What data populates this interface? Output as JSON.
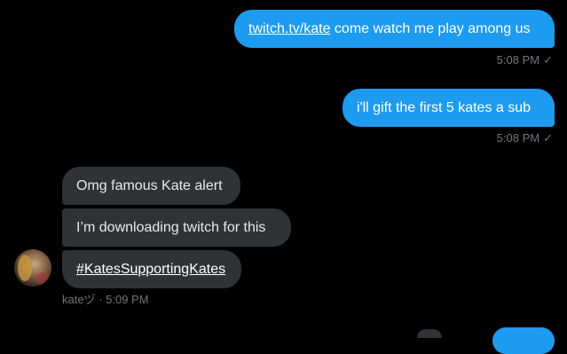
{
  "messages": {
    "sent": [
      {
        "link_text": "twitch.tv/kate",
        "text": " come watch me play among us",
        "time": "5:08 PM",
        "status_icon": "check-icon"
      },
      {
        "text": "i'll gift the first 5 kates a sub",
        "time": "5:08 PM",
        "status_icon": "check-icon"
      }
    ],
    "received": {
      "items": [
        {
          "text": "Omg famous Kate alert"
        },
        {
          "text": "I’m downloading twitch for this"
        },
        {
          "hashtag": "#KatesSupportingKates"
        }
      ],
      "sender": "kateヅ",
      "separator": " · ",
      "time": "5:09 PM",
      "avatar_icon": "user-avatar"
    }
  },
  "glyphs": {
    "check": "✓"
  },
  "colors": {
    "background": "#000000",
    "sent_bubble": "#1d9bf0",
    "received_bubble": "#2f3336",
    "meta_text": "#71767b"
  }
}
